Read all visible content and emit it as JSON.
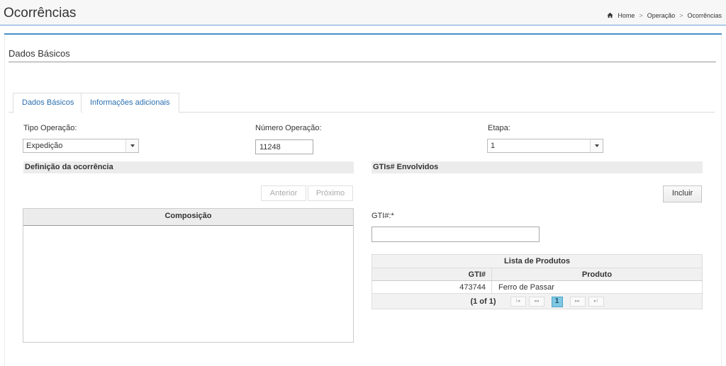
{
  "header": {
    "title": "Ocorrências",
    "breadcrumb": [
      "Home",
      "Operação",
      "Ocorrências"
    ]
  },
  "section": {
    "title": "Dados Básicos"
  },
  "tabs": [
    {
      "label": "Dados Básicos",
      "active": true
    },
    {
      "label": "Informações adicionais",
      "active": false
    }
  ],
  "form": {
    "tipo_label": "Tipo Operação:",
    "tipo_value": "Expedição",
    "numero_label": "Número Operação:",
    "numero_value": "11248",
    "etapa_label": "Etapa:",
    "etapa_value": "1"
  },
  "left": {
    "bar_title": "Definição da ocorrência",
    "prev_label": "Anterior",
    "next_label": "Próximo",
    "composicao_label": "Composição"
  },
  "right": {
    "bar_title": "GTIs# Envolvidos",
    "incluir_label": "Incluir",
    "gti_label": "GTI#:*",
    "gti_value": "",
    "grid": {
      "caption": "Lista de Produtos",
      "columns": [
        "GTI#",
        "Produto"
      ],
      "rows": [
        {
          "gti": "473744",
          "produto": "Ferro de Passar"
        }
      ],
      "pager_status": "(1 of 1)",
      "current_page": "1",
      "first": "I◂",
      "prev": "◂◂",
      "next": "▸▸",
      "last": "▸I"
    }
  },
  "colors": {
    "accent": "#4a90c8",
    "link": "#2a6fb0",
    "page_highlight": "#7ec8e3"
  }
}
